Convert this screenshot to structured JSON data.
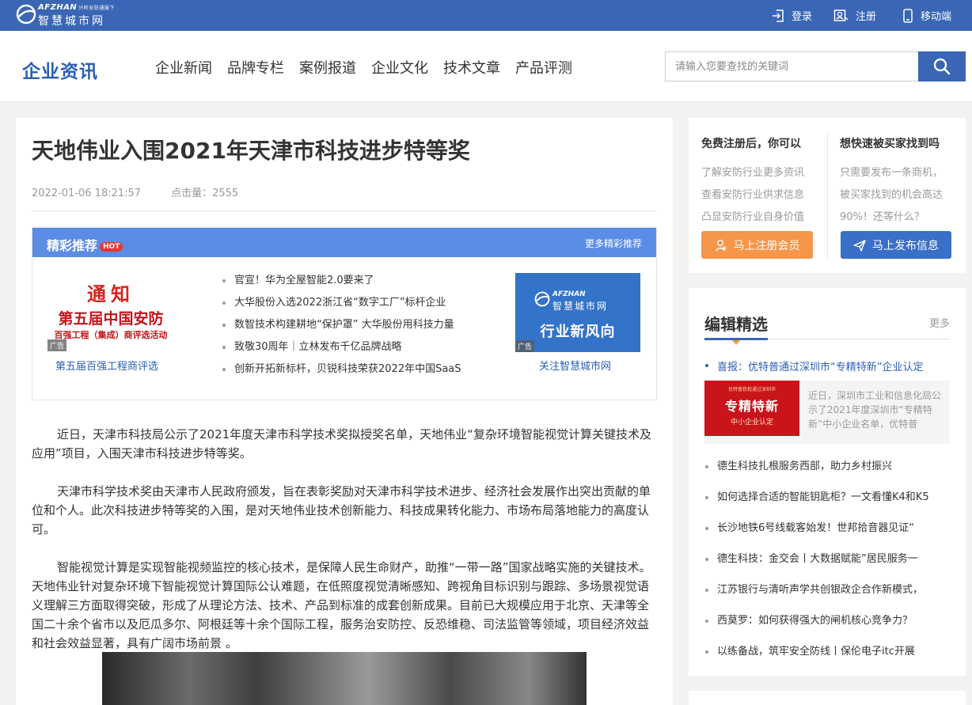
{
  "topbar": {
    "logo_en": "AFZHAN",
    "logo_tag": "兴旺安防通服下",
    "logo_cn": "智慧城市网",
    "login": "登录",
    "register": "注册",
    "mobile": "移动端"
  },
  "header": {
    "brand": "企业资讯",
    "nav": [
      "企业新闻",
      "品牌专栏",
      "案例报道",
      "企业文化",
      "技术文章",
      "产品评测"
    ],
    "search_placeholder": "请输入您要查找的关键词"
  },
  "article": {
    "title": "天地伟业入围2021年天津市科技进步特等奖",
    "date": "2022-01-06 18:21:57",
    "clicks": "点击量：2555",
    "paragraphs": [
      "近日，天津市科技局公示了2021年度天津市科学技术奖拟授奖名单，天地伟业“复杂环境智能视觉计算关键技术及应用”项目，入围天津市科技进步特等奖。",
      "天津市科学技术奖由天津市人民政府颁发，旨在表彰奖励对天津市科学技术进步、经济社会发展作出突出贡献的单位和个人。此次科技进步特等奖的入围，是对天地伟业技术创新能力、科技成果转化能力、市场布局落地能力的高度认可。",
      "智能视觉计算是实现智能视频监控的核心技术，是保障人民生命财产，助推“一带一路”国家战略实施的关键技术。天地伟业针对复杂环境下智能视觉计算国际公认难题，在低照度视觉清晰感知、跨视角目标识别与跟踪、多场景视觉语义理解三方面取得突破，形成了从理论方法、技术、产品到标准的成套创新成果。目前已大规模应用于北京、天津等全国二十余个省市以及厄瓜多尔、阿根廷等十余个国际工程，服务治安防控、反恐维稳、司法监管等领域，项目经济效益和社会效益显著，具有广阔市场前景 。"
    ]
  },
  "recommend": {
    "title": "精彩推荐",
    "hot": "HOT",
    "more": "更多精彩推荐",
    "ad_tag": "广告",
    "left_ad": {
      "line1": "通知",
      "line2": "第五届中国安防",
      "line3": "百强工程（集成）商评选活动",
      "caption": "第五届百强工程商评选"
    },
    "items": [
      "官宣！华为全屋智能2.0要来了",
      "大华股份入选2022浙江省“数字工厂”标杆企业",
      "数智技术构建耕地“保护罩” 大华股份用科技力量",
      "致敬30周年｜立林发布千亿品牌战略",
      "创新开拓新标杆，贝锐科技荣获2022年中国SaaS"
    ],
    "right_ad": {
      "logo_en": "AFZHAN",
      "logo_cn": "智慧城市网",
      "banner": "行业新风向",
      "caption": "关注智慧城市网"
    }
  },
  "register_card": {
    "left_title": "免费注册后，你可以",
    "left_lines": [
      "了解安防行业更多资讯",
      "查看安防行业供求信息",
      "凸显安防行业自身价值"
    ],
    "right_title": "想快速被买家找到吗",
    "right_lines": [
      "只需要发布一条商机，",
      "被买家找到的机会高达",
      "90%！还等什么？"
    ],
    "btn_register": "马上注册会员",
    "btn_publish": "马上发布信息",
    "colors": {
      "orange": "#f5964a",
      "blue": "#3a6fc7"
    }
  },
  "picks": {
    "title": "编辑精选",
    "more": "更多",
    "featured_link": "喜报：优特普通过深圳市“专精特新”企业认定",
    "featured_img": {
      "top": "优特普获批通过深圳市",
      "main": "专精特新",
      "sub": "中小企业认定"
    },
    "featured_text": "近日，深圳市工业和信息化局公示了2021年度深圳市“专精特新”中小企业名单，优特普",
    "items": [
      "德生科技扎根服务西部，助力乡村振兴",
      "如何选择合适的智能钥匙柜？一文看懂K4和K5",
      "长沙地铁6号线载客始发！世邦拾音器见证“",
      "德生科技：金交会丨大数据赋能”居民服务一",
      "江苏银行与清听声学共创银政企合作新模式，",
      "西莫罗：如何获得强大的闸机核心竞争力？",
      "以练备战，筑牢安全防线丨保伦电子itc开展"
    ]
  },
  "colors": {
    "primary": "#3a66b5",
    "link": "#2c5fb3",
    "hot": "#e8372c"
  }
}
